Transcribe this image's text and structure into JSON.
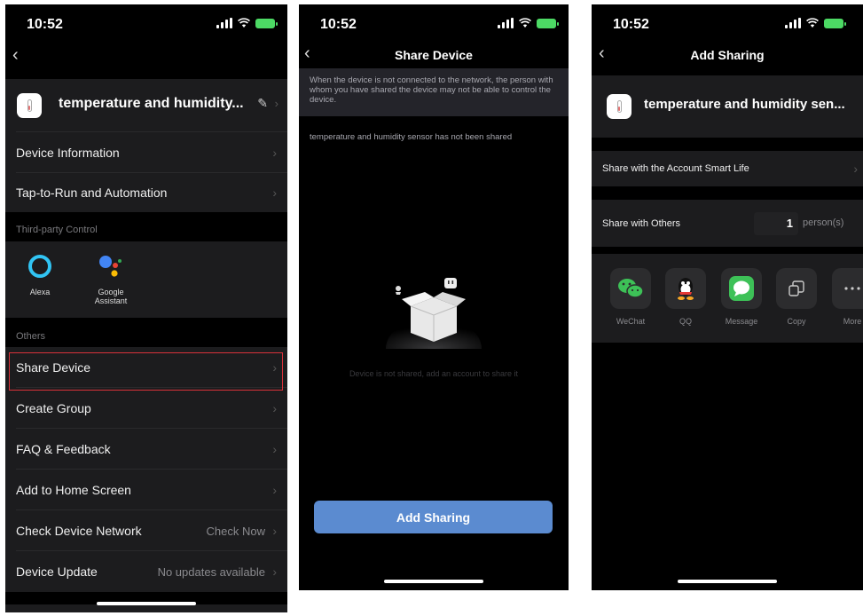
{
  "screen1": {
    "time": "10:52",
    "device_name": "temperature and humidity...",
    "items": [
      {
        "label": "Device Information"
      },
      {
        "label": "Tap-to-Run and Automation"
      }
    ],
    "third_party_label": "Third-party Control",
    "alexa_label": "Alexa",
    "google_label_1": "Google",
    "google_label_2": "Assistant",
    "others_label": "Others",
    "others_items": [
      {
        "label": "Share Device",
        "value": ""
      },
      {
        "label": "Create Group",
        "value": ""
      },
      {
        "label": "FAQ & Feedback",
        "value": ""
      },
      {
        "label": "Add to Home Screen",
        "value": ""
      },
      {
        "label": "Check Device Network",
        "value": "Check Now"
      },
      {
        "label": "Device Update",
        "value": "No updates available"
      }
    ]
  },
  "screen2": {
    "time": "10:52",
    "title": "Share Device",
    "notice": "When the device is not connected to the network, the person with whom you have shared the device may not be able to control the device.",
    "status": "temperature and humidity sensor has not been shared",
    "empty_text": "Device is not shared, add an account to share it",
    "add_button": "Add Sharing"
  },
  "screen3": {
    "time": "10:52",
    "title": "Add Sharing",
    "device_name": "temperature and humidity sen...",
    "share_account": "Share with the Account Smart Life",
    "share_others": "Share with Others",
    "count": "1",
    "count_unit": "person(s)",
    "apps": [
      {
        "label": "WeChat"
      },
      {
        "label": "QQ"
      },
      {
        "label": "Message"
      },
      {
        "label": "Copy"
      },
      {
        "label": "More"
      }
    ]
  }
}
